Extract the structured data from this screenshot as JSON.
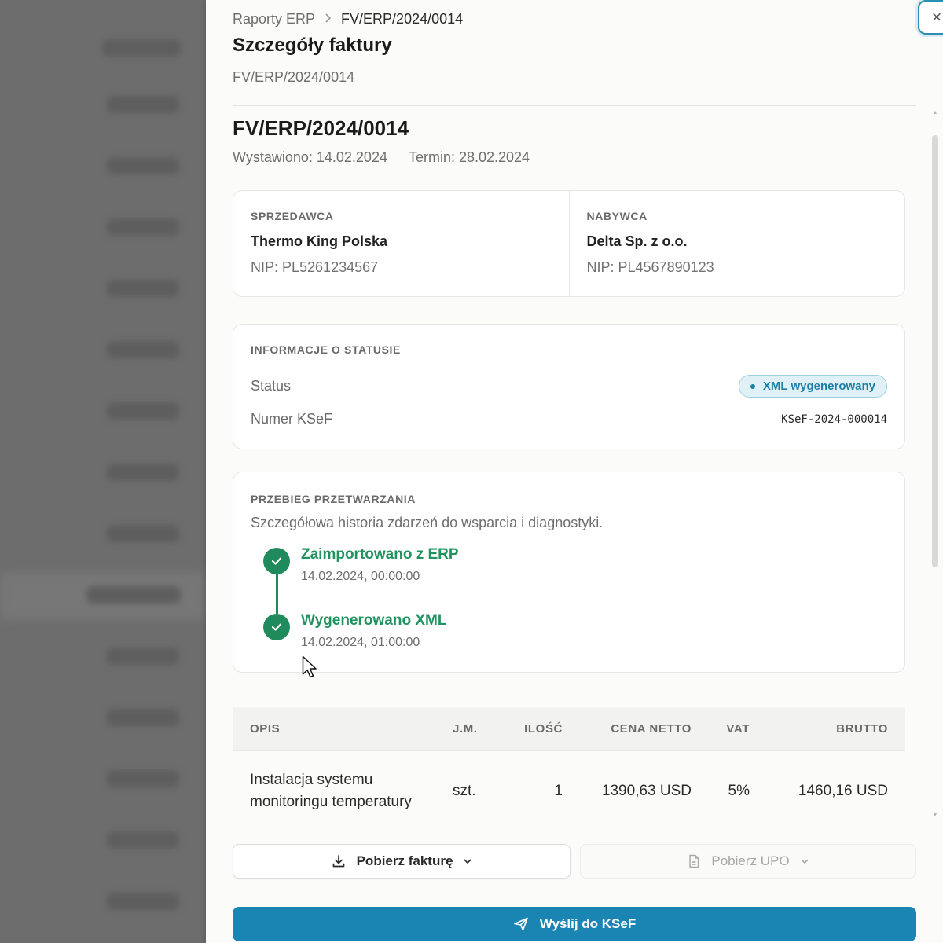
{
  "breadcrumb": {
    "parent": "Raporty ERP",
    "current": "FV/ERP/2024/0014"
  },
  "header": {
    "title": "Szczegóły faktury",
    "subtitle": "FV/ERP/2024/0014",
    "close_label": "×"
  },
  "invoice": {
    "number": "FV/ERP/2024/0014",
    "issued": "Wystawiono: 14.02.2024",
    "due": "Termin: 28.02.2024"
  },
  "seller": {
    "label": "SPRZEDAWCA",
    "name": "Thermo King Polska",
    "nip": "NIP: PL5261234567"
  },
  "buyer": {
    "label": "NABYWCA",
    "name": "Delta Sp. z o.o.",
    "nip": "NIP: PL4567890123"
  },
  "status_info": {
    "label": "INFORMACJE O STATUSIE",
    "status_key": "Status",
    "status_value": "XML wygenerowany",
    "ksef_key": "Numer KSeF",
    "ksef_value": "KSeF-2024-000014"
  },
  "process": {
    "label": "PRZEBIEG PRZETWARZANIA",
    "description": "Szczegółowa historia zdarzeń do wsparcia i diagnostyki.",
    "events": [
      {
        "title": "Zaimportowano z ERP",
        "time": "14.02.2024, 00:00:00"
      },
      {
        "title": "Wygenerowano XML",
        "time": "14.02.2024, 01:00:00"
      }
    ]
  },
  "table": {
    "headers": {
      "opis": "OPIS",
      "jm": "J.M.",
      "ilosc": "ILOŚĆ",
      "cena": "CENA NETTO",
      "vat": "VAT",
      "brutto": "BRUTTO"
    },
    "rows": [
      {
        "opis": "Instalacja systemu monitoringu temperatury",
        "jm": "szt.",
        "ilosc": "1",
        "cena": "1390,63 USD",
        "vat": "5%",
        "brutto": "1460,16 USD"
      }
    ]
  },
  "footer": {
    "download_label": "Pobierz fakturę",
    "upo_label": "Pobierz UPO",
    "send_label": "Wyślij do KSeF"
  },
  "colors": {
    "accent": "#1a84b3",
    "success": "#1f8a5b",
    "badge_bg": "#dff0f6"
  }
}
